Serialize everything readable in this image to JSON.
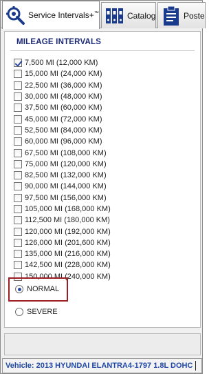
{
  "tabs": [
    {
      "label": "Service Intervals+",
      "suffix": "™",
      "icon": "wrench-gear-icon",
      "active": true
    },
    {
      "label": "Catalog",
      "icon": "binders-icon",
      "active": false
    },
    {
      "label": "Poster",
      "icon": "clipboard-icon",
      "active": false
    }
  ],
  "mileage": {
    "title": "MILEAGE INTERVALS",
    "items": [
      {
        "label": "7,500 MI (12,000 KM)",
        "checked": true
      },
      {
        "label": "15,000 MI (24,000 KM)",
        "checked": false
      },
      {
        "label": "22,500 MI (36,000 KM)",
        "checked": false
      },
      {
        "label": "30,000 MI (48,000 KM)",
        "checked": false
      },
      {
        "label": "37,500 MI (60,000 KM)",
        "checked": false
      },
      {
        "label": "45,000 MI (72,000 KM)",
        "checked": false
      },
      {
        "label": "52,500 MI (84,000 KM)",
        "checked": false
      },
      {
        "label": "60,000 MI (96,000 KM)",
        "checked": false
      },
      {
        "label": "67,500 MI (108,000 KM)",
        "checked": false
      },
      {
        "label": "75,000 MI (120,000 KM)",
        "checked": false
      },
      {
        "label": "82,500 MI (132,000 KM)",
        "checked": false
      },
      {
        "label": "90,000 MI (144,000 KM)",
        "checked": false
      },
      {
        "label": "97,500 MI (156,000 KM)",
        "checked": false
      },
      {
        "label": "105,000 MI (168,000 KM)",
        "checked": false
      },
      {
        "label": "112,500 MI (180,000 KM)",
        "checked": false
      },
      {
        "label": "120,000 MI (192,000 KM)",
        "checked": false
      },
      {
        "label": "126,000 MI (201,600 KM)",
        "checked": false
      },
      {
        "label": "135,000 MI (216,000 KM)",
        "checked": false
      },
      {
        "label": "142,500 MI (228,000 KM)",
        "checked": false
      },
      {
        "label": "150,000 MI (240,000 KM)",
        "checked": false
      }
    ]
  },
  "conditions": {
    "normal_label": "NORMAL",
    "severe_label": "SEVERE",
    "selected": "NORMAL"
  },
  "status": {
    "vehicle": "Vehicle: 2013 HYUNDAI ELANTRA4-1797 1.8L DOHC"
  },
  "colors": {
    "title": "#1b2a78",
    "status_text": "#1d47a8",
    "highlight": "#9c1e22"
  }
}
